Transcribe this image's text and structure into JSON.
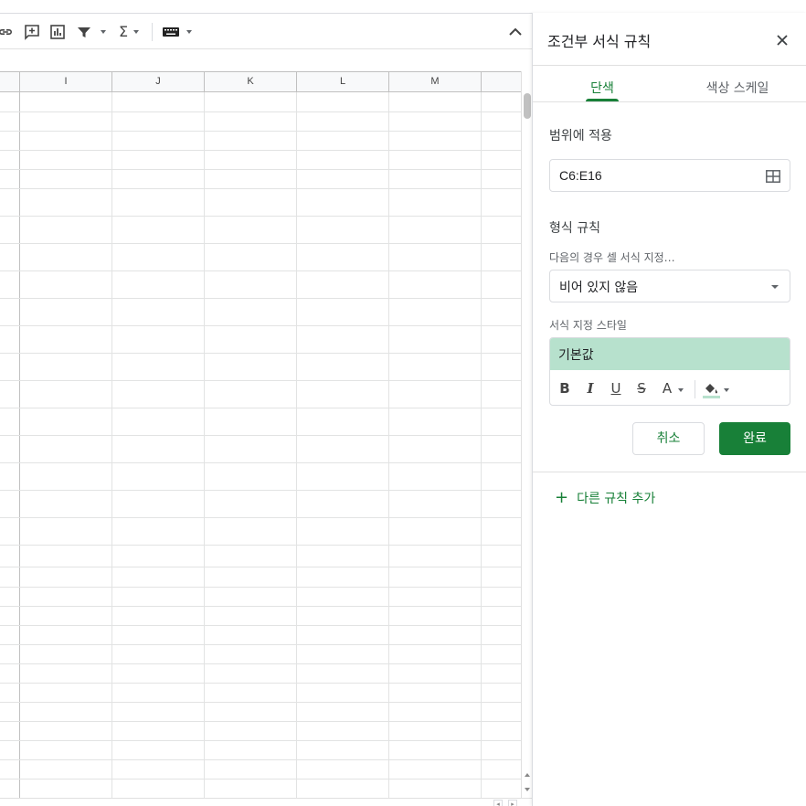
{
  "toolbar": {
    "icons": [
      "link-icon",
      "add-comment-icon",
      "insert-chart-icon",
      "filter-icon",
      "functions-icon",
      "input-tools-icon"
    ],
    "sigma": "Σ"
  },
  "grid": {
    "columns": [
      "I",
      "J",
      "K",
      "L",
      "M"
    ]
  },
  "sidebar": {
    "title": "조건부 서식 규칙",
    "tabs": [
      {
        "label": "단색",
        "active": true
      },
      {
        "label": "색상 스케일",
        "active": false
      }
    ],
    "apply_range_label": "범위에 적용",
    "range_value": "C6:E16",
    "format_rules_label": "형식 규칙",
    "condition_label": "다음의 경우 셀 서식 지정…",
    "condition_value": "비어 있지 않음",
    "style_label": "서식 지정 스타일",
    "style_preview": "기본값",
    "style_preview_color": "#b7e1cd",
    "format_buttons": {
      "bold": "B",
      "italic": "I",
      "underline": "U",
      "strike": "S",
      "text_color": "A"
    },
    "cancel_label": "취소",
    "done_label": "완료",
    "add_rule_label": "다른 규칙 추가",
    "add_rule_plus": "+"
  },
  "colors": {
    "accent_green": "#188038",
    "preview_fill": "#b7e1cd"
  }
}
